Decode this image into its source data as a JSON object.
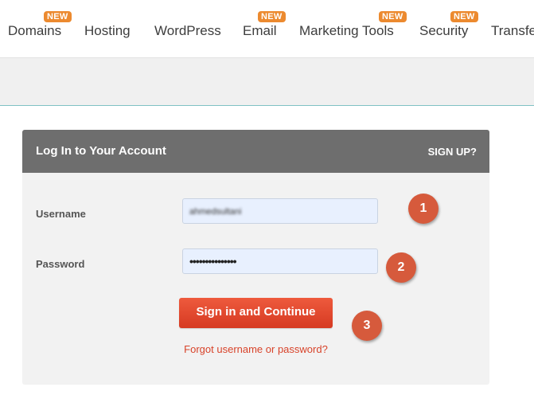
{
  "nav": {
    "items": [
      {
        "label": "Domains",
        "badge": "NEW"
      },
      {
        "label": "Hosting",
        "badge": ""
      },
      {
        "label": "WordPress",
        "badge": ""
      },
      {
        "label": "Email",
        "badge": "NEW"
      },
      {
        "label": "Marketing Tools",
        "badge": "NEW"
      },
      {
        "label": "Security",
        "badge": "NEW"
      },
      {
        "label": "Transfe",
        "badge": ""
      }
    ]
  },
  "login": {
    "title": "Log In to Your Account",
    "signup_label": "SIGN UP?",
    "username_label": "Username",
    "username_value": "ahmedsultani",
    "password_label": "Password",
    "password_value": "•••••••••••••••",
    "submit_label": "Sign in and Continue",
    "forgot_label": "Forgot username or password?"
  },
  "steps": [
    "1",
    "2",
    "3"
  ],
  "colors": {
    "badge": "#ec8a2f",
    "header": "#6e6e6e",
    "button": "#e0472d",
    "link": "#d8432a",
    "step": "#d65a3c"
  }
}
